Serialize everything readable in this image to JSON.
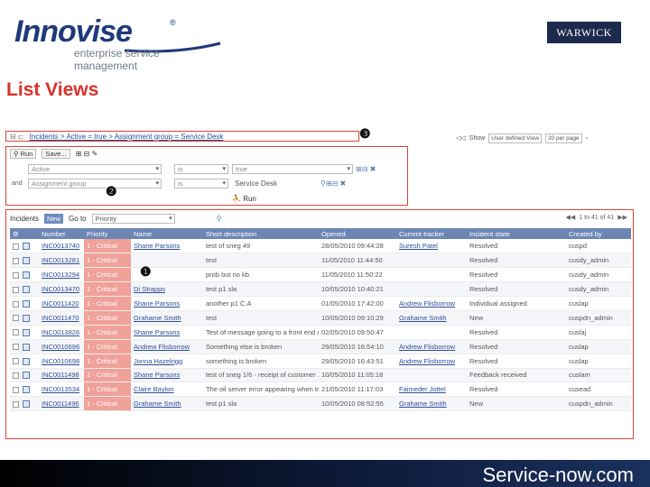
{
  "branding": {
    "logo_text": "Innovise",
    "logo_reg": "®",
    "logo_sub": "enterprise service management",
    "partner_logo": "WARWICK",
    "footer_logo": "Service-now.com"
  },
  "page": {
    "title": "List Views"
  },
  "markers": {
    "one": "❶",
    "two": "❷",
    "three": "❸"
  },
  "breadcrumb": {
    "icons": "⊟ ⊏",
    "text": "Incidents > Active = true > Assignment group = Service Desk"
  },
  "list_controls": {
    "nav_back": "◁◁",
    "show_label": "Show",
    "view_select": "User defined View",
    "per_page": "20 per page",
    "close_icon": "▫"
  },
  "filter": {
    "run_label": "Run",
    "save_label": "Save...",
    "conditions": [
      {
        "prefix": "",
        "field": "Active",
        "operator": "is",
        "value": "true"
      },
      {
        "prefix": "and",
        "field": "Assignment group",
        "operator": "is",
        "value": "Service Desk"
      }
    ],
    "run_bottom": "Run"
  },
  "list": {
    "name": "Incidents",
    "new_label": "New",
    "goto_label": "Go to",
    "goto_value": "Priority",
    "pager": "1 to 41 of 41",
    "columns": [
      "Number",
      "Priority",
      "Name",
      "Short description",
      "Opened",
      "Current tracker",
      "Incident state",
      "Created by"
    ],
    "rows": [
      [
        "INC0013740",
        "1 - Critical",
        "Shane Parsons",
        "test of sneg 49",
        "28/05/2010 09:44:28",
        "Suresh Patel",
        "Resolved",
        "cuspd"
      ],
      [
        "INC0013281",
        "1 - Critical",
        "",
        "test",
        "11/05/2010 11:44:50",
        "",
        "Resolved",
        "cusdy_admin"
      ],
      [
        "INC0013294",
        "1 - Critical",
        "",
        "prob but no kb",
        "11/05/2010 11:50:22",
        "",
        "Resolved",
        "cusdy_admin"
      ],
      [
        "INC0013470",
        "1 - Critical",
        "Di Strapps",
        "test p1 sla",
        "10/05/2010 10:40:21",
        "",
        "Resolved",
        "cusdy_admin"
      ],
      [
        "INC0011420",
        "1 - Critical",
        "Shane Parsons",
        "another p1 C.A",
        "01/05/2010 17:42:00",
        "Andrew Flisborrow",
        "Individual assigned",
        "cuslap"
      ],
      [
        "INC0011470",
        "1 - Critical",
        "Grahame Smith",
        "test",
        "10/05/2010 09:10:29",
        "Grahame Smith",
        "New",
        "cuspdn_admin"
      ],
      [
        "INC0013826",
        "1 - Critical",
        "Shane Parsons",
        "Test of message going to a front end user",
        "02/05/2010 09:50:47",
        "",
        "Resolved",
        "cuslaj"
      ],
      [
        "INC0010696",
        "1 - Critical",
        "Andrew Flisborrow",
        "Something else is broken",
        "29/05/2010 16:54:10",
        "Andrew Flisborrow",
        "Resolved",
        "cuslap"
      ],
      [
        "INC0010698",
        "1 - Critical",
        "Jonna Hazelrigg",
        "something is broken",
        "29/05/2010 16:43:51",
        "Andrew Flisborrow",
        "Resolved",
        "cuslap"
      ],
      [
        "INC0011498",
        "1 - Critical",
        "Shane Parsons",
        "test of sneg 1/6 - receipt of customer ...",
        "10/05/2010 11:05:18",
        "",
        "Feedback received",
        "cuslam"
      ],
      [
        "INC0013534",
        "1 - Critical",
        "Claire Baylon",
        "The oil server error appearing when try...",
        "21/05/2010 11:17:03",
        "Faimeder Jottel",
        "Resolved",
        "cusead"
      ],
      [
        "INC0011496",
        "1 - Critical",
        "Grahame Smith",
        "test p1 sla",
        "10/05/2010 08:52:55",
        "Grahame Smith",
        "New",
        "cuspdn_admin"
      ]
    ]
  }
}
